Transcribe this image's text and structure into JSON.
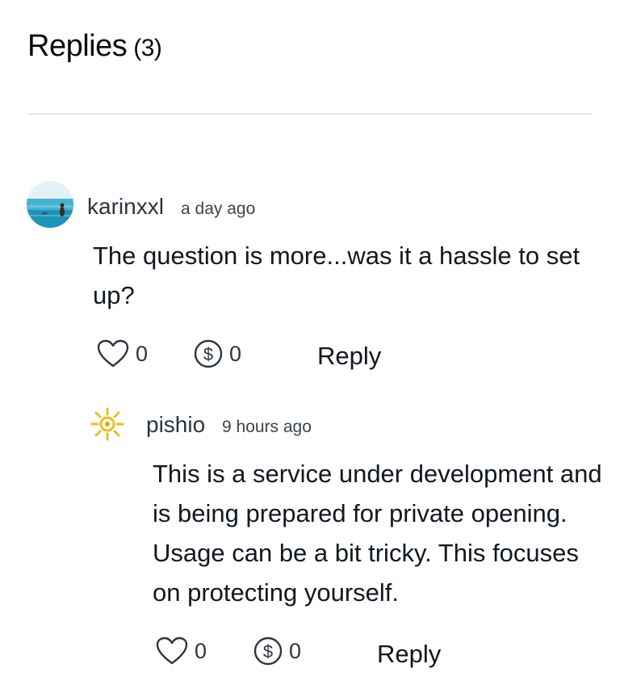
{
  "header": {
    "title": "Replies",
    "count": "(3)"
  },
  "comments": [
    {
      "username": "karinxxl",
      "time": "a day ago",
      "text": "The question is more...was it a hassle to set up?",
      "likes": "0",
      "tips": "0",
      "reply_label": "Reply",
      "avatar_icon": "beach-photo-avatar"
    },
    {
      "username": "pishio",
      "time": "9 hours ago",
      "text": "This is a service under development and is being prepared for private opening. Usage can be a bit tricky. This focuses on protecting yourself.",
      "likes": "0",
      "tips": "0",
      "reply_label": "Reply",
      "avatar_icon": "sun-logo-avatar"
    }
  ],
  "colors": {
    "text": "#111820",
    "muted": "#3b4450",
    "divider": "#e6e8eb",
    "avatar_logo": "#e8c21a"
  }
}
